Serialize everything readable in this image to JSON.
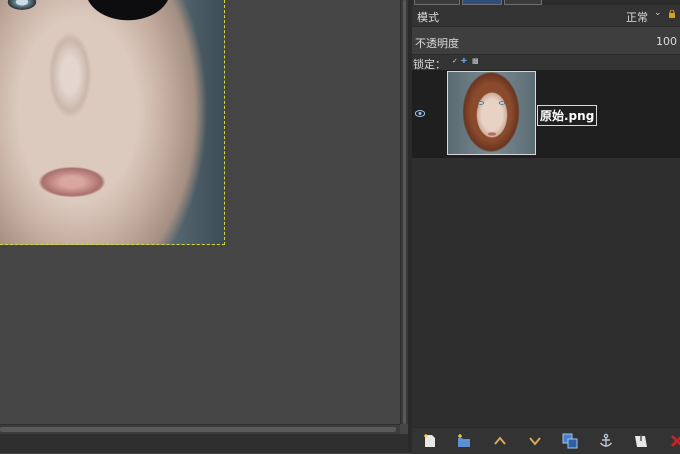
{
  "canvas": {
    "image_alt": "",
    "selection_color": "#d6d636"
  },
  "layers_panel": {
    "mode": {
      "label": "模式",
      "value": "正常"
    },
    "opacity": {
      "label": "不透明度",
      "value": "100"
    },
    "lock": {
      "label": "锁定："
    },
    "layers": [
      {
        "name": "原始.png",
        "visible": true
      }
    ],
    "toolbar_icons": [
      "new-layer-icon",
      "new-layer-group-icon",
      "raise-layer-icon",
      "lower-layer-icon",
      "duplicate-layer-icon",
      "anchor-layer-icon",
      "merge-down-icon",
      "delete-layer-icon"
    ]
  },
  "colors": {
    "canvas_bg": "#454545",
    "panel_bg": "#333333",
    "selected_row": "#1f1f1f",
    "accent_blue": "#4a7fd0",
    "delete_red": "#cc2222"
  }
}
